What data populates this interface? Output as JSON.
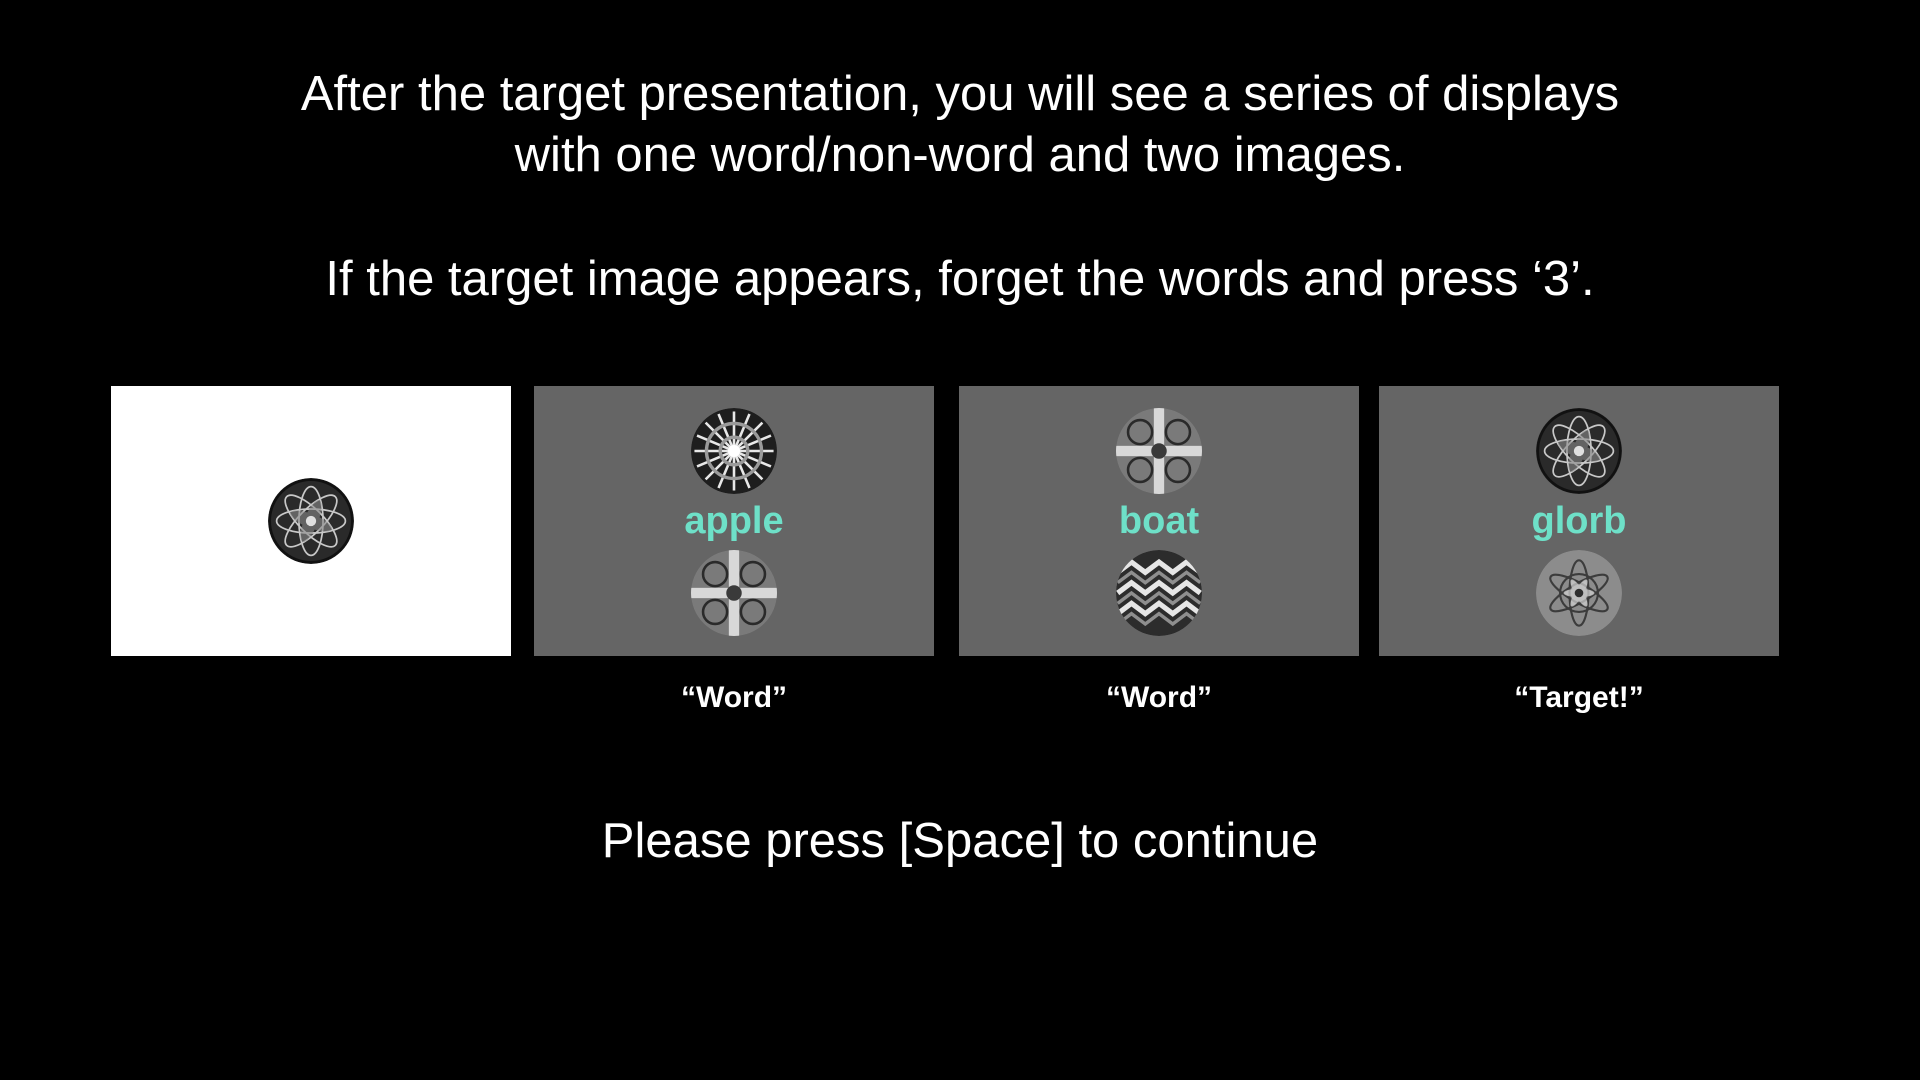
{
  "instructions": {
    "line1": "After the target presentation, you will see a series of displays",
    "line2": "with one word/non-word and two images.",
    "line3": "If the target image appears, forget the words and press ‘3’."
  },
  "colors": {
    "background": "#000000",
    "text": "#ffffff",
    "target_panel": "#ffffff",
    "trial_panel": "#656565",
    "probe_word": "#6ee0c8"
  },
  "target_panel": {
    "image_icon": "fractal-target-icon"
  },
  "trials": [
    {
      "word": "apple",
      "top_image_icon": "fractal-starburst-icon",
      "bottom_image_icon": "fractal-cross-icon",
      "response": "“Word”"
    },
    {
      "word": "boat",
      "top_image_icon": "fractal-cross-icon",
      "bottom_image_icon": "fractal-zigzag-icon",
      "response": "“Word”"
    },
    {
      "word": "glorb",
      "top_image_icon": "fractal-target-icon",
      "bottom_image_icon": "fractal-ornate-icon",
      "response": "“Target!”"
    }
  ],
  "footer": {
    "continue_prompt": "Please press [Space] to continue"
  }
}
